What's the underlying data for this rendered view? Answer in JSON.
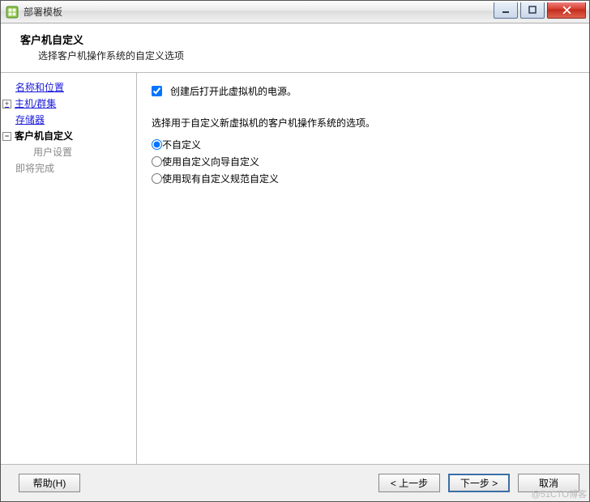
{
  "window": {
    "title": "部署模板"
  },
  "header": {
    "title": "客户机自定义",
    "subtitle": "选择客户机操作系统的自定义选项"
  },
  "sidebar": {
    "items": [
      {
        "label": "名称和位置",
        "type": "link",
        "expand": null
      },
      {
        "label": "主机/群集",
        "type": "link",
        "expand": "plus"
      },
      {
        "label": "存储器",
        "type": "link",
        "expand": null
      },
      {
        "label": "客户机自定义",
        "type": "current",
        "expand": "minus"
      },
      {
        "label": "用户设置",
        "type": "disabled",
        "indent": true
      },
      {
        "label": "即将完成",
        "type": "disabled"
      }
    ]
  },
  "content": {
    "power_on_label": "创建后打开此虚拟机的电源。",
    "power_on_checked": true,
    "prompt": "选择用于自定义新虚拟机的客户机操作系统的选项。",
    "radios": {
      "selected": 0,
      "options": [
        "不自定义",
        "使用自定义向导自定义",
        "使用现有自定义规范自定义"
      ]
    }
  },
  "footer": {
    "help": "帮助(H)",
    "back": "< 上一步",
    "next": "下一步 >",
    "cancel": "取消"
  },
  "watermark": "@51CTO博客"
}
